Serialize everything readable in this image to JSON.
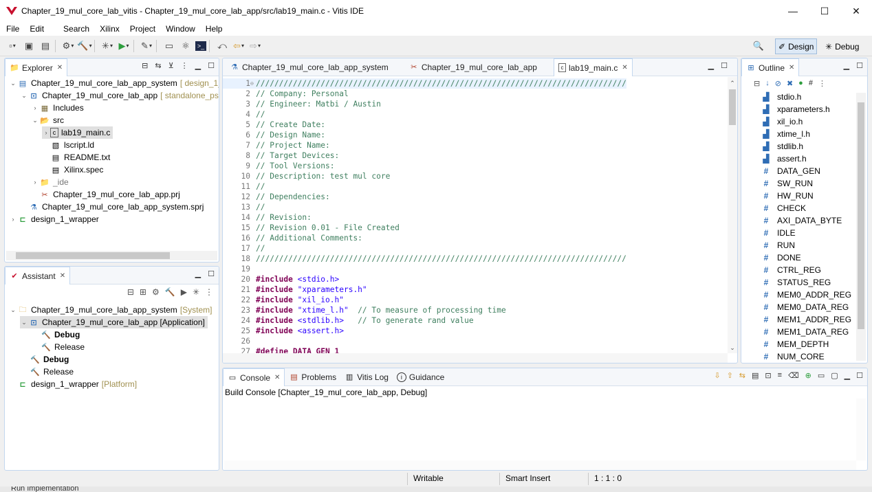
{
  "window": {
    "title": "Chapter_19_mul_core_lab_vitis - Chapter_19_mul_core_lab_app/src/lab19_main.c - Vitis IDE",
    "minimize": "—",
    "maximize": "☐",
    "close": "✕"
  },
  "menu": [
    "File",
    "Edit",
    "Search",
    "Xilinx",
    "Project",
    "Window",
    "Help"
  ],
  "perspectives": {
    "design": "Design",
    "debug": "Debug"
  },
  "explorer": {
    "tab": "Explorer",
    "items": [
      {
        "label": "Chapter_19_mul_core_lab_app_system",
        "dec": "[ design_1_"
      },
      {
        "label": "Chapter_19_mul_core_lab_app",
        "dec": "[ standalone_ps7"
      },
      {
        "label": "Includes",
        "dec": ""
      },
      {
        "label": "src",
        "dec": ""
      },
      {
        "label": "lab19_main.c",
        "dec": ""
      },
      {
        "label": "lscript.ld",
        "dec": ""
      },
      {
        "label": "README.txt",
        "dec": ""
      },
      {
        "label": "Xilinx.spec",
        "dec": ""
      },
      {
        "label": "_ide",
        "dec": ""
      },
      {
        "label": "Chapter_19_mul_core_lab_app.prj",
        "dec": ""
      },
      {
        "label": "Chapter_19_mul_core_lab_app_system.sprj",
        "dec": ""
      },
      {
        "label": "design_1_wrapper",
        "dec": ""
      }
    ]
  },
  "assistant": {
    "tab": "Assistant",
    "items": [
      {
        "label": "Chapter_19_mul_core_lab_app_system",
        "dec": "[System]"
      },
      {
        "label": "Chapter_19_mul_core_lab_app [Application]",
        "dec": ""
      },
      {
        "label": "Debug",
        "dec": ""
      },
      {
        "label": "Release",
        "dec": ""
      },
      {
        "label": "Debug",
        "dec": ""
      },
      {
        "label": "Release",
        "dec": ""
      },
      {
        "label": "design_1_wrapper",
        "dec": "[Platform]"
      }
    ]
  },
  "editor": {
    "tabs": [
      "Chapter_19_mul_core_lab_app_system",
      "Chapter_19_mul_core_lab_app",
      "lab19_main.c"
    ],
    "lines": [
      {
        "n": "1",
        "t": "////////////////////////////////////////////////////////////////////////////////",
        "k": "c"
      },
      {
        "n": "2",
        "t": "// Company: Personal",
        "k": "c"
      },
      {
        "n": "3",
        "t": "// Engineer: Matbi / Austin",
        "k": "c"
      },
      {
        "n": "4",
        "t": "//",
        "k": "c"
      },
      {
        "n": "5",
        "t": "// Create Date:",
        "k": "c"
      },
      {
        "n": "6",
        "t": "// Design Name:",
        "k": "c"
      },
      {
        "n": "7",
        "t": "// Project Name:",
        "k": "c"
      },
      {
        "n": "8",
        "t": "// Target Devices:",
        "k": "c"
      },
      {
        "n": "9",
        "t": "// Tool Versions:",
        "k": "c"
      },
      {
        "n": "10",
        "t": "// Description: test mul core",
        "k": "c"
      },
      {
        "n": "11",
        "t": "//",
        "k": "c"
      },
      {
        "n": "12",
        "t": "// Dependencies:",
        "k": "c"
      },
      {
        "n": "13",
        "t": "//",
        "k": "c"
      },
      {
        "n": "14",
        "t": "// Revision:",
        "k": "c"
      },
      {
        "n": "15",
        "t": "// Revision 0.01 - File Created",
        "k": "c"
      },
      {
        "n": "16",
        "t": "// Additional Comments:",
        "k": "c"
      },
      {
        "n": "17",
        "t": "//",
        "k": "c"
      },
      {
        "n": "18",
        "t": "////////////////////////////////////////////////////////////////////////////////",
        "k": "c"
      },
      {
        "n": "19",
        "t": "",
        "k": "c"
      },
      {
        "n": "20",
        "t": "#include",
        "s": " <stdio.h>",
        "r": "",
        "k": "p"
      },
      {
        "n": "21",
        "t": "#include",
        "s": " \"xparameters.h\"",
        "r": "",
        "k": "p"
      },
      {
        "n": "22",
        "t": "#include",
        "s": " \"xil_io.h\"",
        "r": "",
        "k": "p"
      },
      {
        "n": "23",
        "t": "#include",
        "s": " \"xtime_l.h\"",
        "r": "  // To measure of processing time",
        "k": "p"
      },
      {
        "n": "24",
        "t": "#include",
        "s": " <stdlib.h>",
        "r": "   // To generate rand value",
        "k": "p"
      },
      {
        "n": "25",
        "t": "#include",
        "s": " <assert.h>",
        "r": "",
        "k": "p"
      },
      {
        "n": "26",
        "t": "",
        "k": "c"
      },
      {
        "n": "27",
        "t": "#define DATA_GEN 1",
        "k": "p"
      }
    ]
  },
  "outline": {
    "tab": "Outline",
    "items": [
      {
        "label": "stdio.h",
        "type": "include"
      },
      {
        "label": "xparameters.h",
        "type": "include"
      },
      {
        "label": "xil_io.h",
        "type": "include"
      },
      {
        "label": "xtime_l.h",
        "type": "include"
      },
      {
        "label": "stdlib.h",
        "type": "include"
      },
      {
        "label": "assert.h",
        "type": "include"
      },
      {
        "label": "DATA_GEN",
        "type": "define"
      },
      {
        "label": "SW_RUN",
        "type": "define"
      },
      {
        "label": "HW_RUN",
        "type": "define"
      },
      {
        "label": "CHECK",
        "type": "define"
      },
      {
        "label": "AXI_DATA_BYTE",
        "type": "define"
      },
      {
        "label": "IDLE",
        "type": "define"
      },
      {
        "label": "RUN",
        "type": "define"
      },
      {
        "label": "DONE",
        "type": "define"
      },
      {
        "label": "CTRL_REG",
        "type": "define"
      },
      {
        "label": "STATUS_REG",
        "type": "define"
      },
      {
        "label": "MEM0_ADDR_REG",
        "type": "define"
      },
      {
        "label": "MEM0_DATA_REG",
        "type": "define"
      },
      {
        "label": "MEM1_ADDR_REG",
        "type": "define"
      },
      {
        "label": "MEM1_DATA_REG",
        "type": "define"
      },
      {
        "label": "MEM_DEPTH",
        "type": "define"
      },
      {
        "label": "NUM_CORE",
        "type": "define"
      }
    ]
  },
  "console": {
    "tabs": [
      "Console",
      "Problems",
      "Vitis Log",
      "Guidance"
    ],
    "header": "Build Console [Chapter_19_mul_core_lab_app, Debug]"
  },
  "status": {
    "writable": "Writable",
    "insert": "Smart Insert",
    "position": "1 : 1 : 0"
  },
  "bottom_strip": "Run Implementation",
  "colors": {
    "accent": "#2f6db5",
    "comment": "#3f7f5f",
    "keyword": "#7f0055",
    "string": "#2a00ff",
    "decoration": "#a09050"
  }
}
